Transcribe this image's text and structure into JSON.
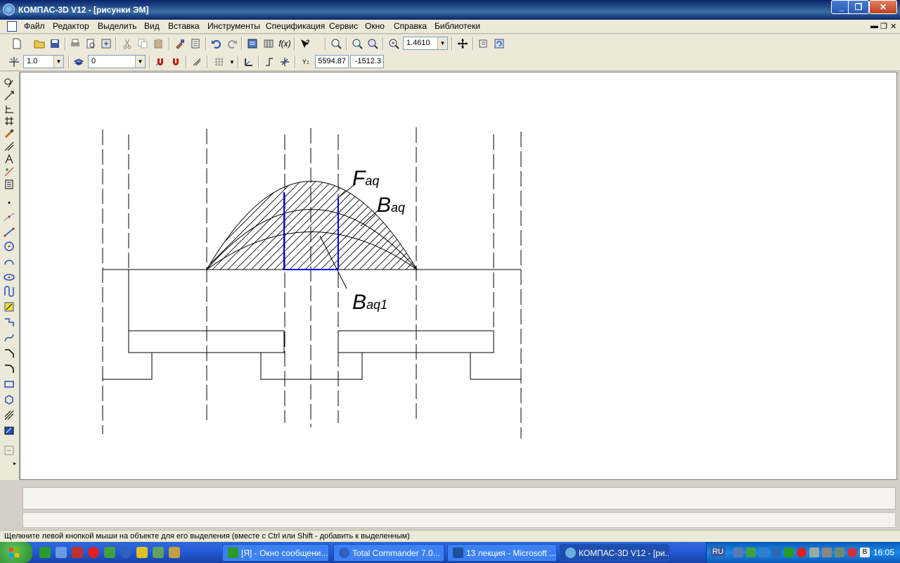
{
  "window": {
    "title": "КОМПАС-3D V12 - [рисунки ЭМ]",
    "controls": {
      "minimize": "_",
      "maximize": "❐",
      "close": "✕"
    }
  },
  "menu": {
    "items": [
      "Файл",
      "Редактор",
      "Выделить",
      "Вид",
      "Вставка",
      "Инструменты",
      "Спецификация",
      "Сервис",
      "Окно",
      "Справка",
      "Библиотеки"
    ],
    "mdi_controls": [
      "▬",
      "❐",
      "✕"
    ]
  },
  "toolbar1": {
    "zoom_value": "1.4610",
    "function_label": "f(x)"
  },
  "toolbar2": {
    "step_value": "1.0",
    "layer_value": "0",
    "coord_x": "5594.87",
    "coord_y": "-1512.3"
  },
  "drawing": {
    "labels": {
      "f_main": "F",
      "f_sub": "aq",
      "b_main": "B",
      "b_sub": "aq",
      "b1_main": "B",
      "b1_sub": "aq1"
    },
    "colors": {
      "line": "#000000",
      "highlight": "#0000ff"
    }
  },
  "status": {
    "message": "Щелкните левой кнопкой мыши на объекте для его выделения (вместе с Ctrl или Shift - добавить к выделенным)"
  },
  "taskbar": {
    "tasks": [
      {
        "label": "[Я] - Окно сообщени...",
        "active": false
      },
      {
        "label": "Total Commander 7.0...",
        "active": false
      },
      {
        "label": "13 лекция - Microsoft ...",
        "active": false
      },
      {
        "label": "КОМПАС-3D V12 - [ри...",
        "active": true
      }
    ],
    "language": "RU",
    "clock": "16:05"
  }
}
